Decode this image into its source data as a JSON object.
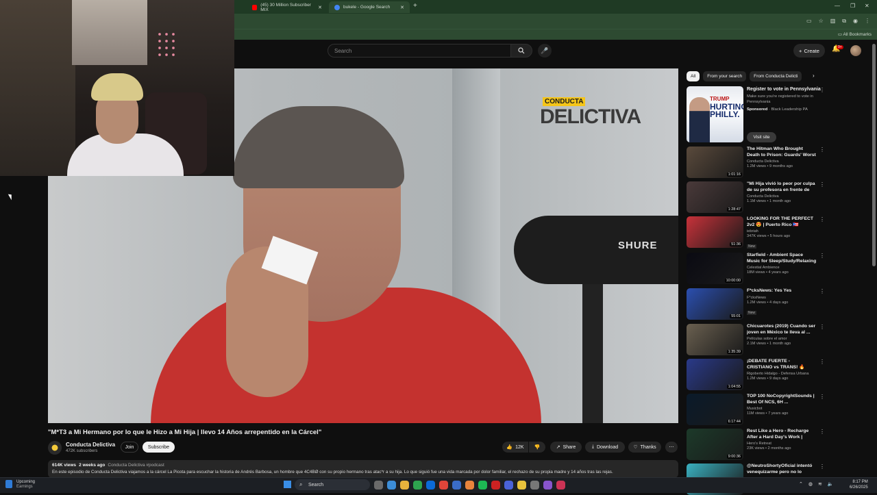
{
  "browser": {
    "tabs": [
      {
        "label": "(45) 30 Million Subscriber MIX",
        "favicon_color": "#ff0000"
      },
      {
        "label": "bukele - Google Search",
        "favicon_color": "#4285f4"
      }
    ],
    "bookmarks_label": "All Bookmarks"
  },
  "youtube": {
    "search_placeholder": "Search",
    "create_label": "Create",
    "notif_count": "9+"
  },
  "video": {
    "overlay_logo_small": "CONDUCTA",
    "overlay_logo_big": "DELICTIVA",
    "mic_brand": "SHURE",
    "title": "\"M*T3 a Mi Hermano por lo que le Hizo a Mi Hija | llevo 14 Años arrepentido en la Cárcel\"",
    "channel": "Conducta Delictiva",
    "subscribers": "472K subscribers",
    "join_label": "Join",
    "subscribe_label": "Subscribe",
    "likes": "12K",
    "share_label": "Share",
    "download_label": "Download",
    "thanks_label": "Thanks",
    "views": "614K views",
    "age": "2 weeks ago",
    "tags": "Conducta Delictiva #podcast",
    "description": "En este episodio de Conducta Delictiva viajamos a la cárcel La Picota para escuchar la historia de Andrés Barbosa, un hombre que 4C4BØ con su propio hermano tras atac*r a su hija. Lo que siguió fue una vida marcada por dolor familiar, el rechazo de su propia madre y 14 años tras las rejas."
  },
  "sidebar": {
    "chips": [
      "All",
      "From your search",
      "From Conducta Delicti"
    ],
    "ad": {
      "thumb_line1": "TRUMP",
      "thumb_line2": "HURTING PHILLY.",
      "title": "Register to vote in Pennsylvania",
      "subtitle": "Make sure you're registered to vote in Pennsylvania",
      "sponsored": "Sponsored",
      "advertiser": "Black Leadership PA",
      "visit_label": "Visit site"
    },
    "recs": [
      {
        "title": "The Hitman Who Brought Death to Prison: Guards' Worst ...",
        "channel": "Conducta Delictiva",
        "meta": "1.2M views • 9 months ago",
        "duration": "1:01:16",
        "color": "#5a4a3c"
      },
      {
        "title": "\"Mi Hija vivió lo peor por culpa de su profesora en frente de s...",
        "channel": "Conducta Delictiva",
        "meta": "1.1M views • 1 month ago",
        "duration": "1:28:47",
        "color": "#4a3a3a"
      },
      {
        "title": "LOOKING FOR THE PERFECT 2v2 😍 | Puerto Rico 🇵🇷",
        "channel": "iebriah",
        "meta": "347K views • 5 hours ago",
        "duration": "51:36",
        "color": "#c8323a",
        "new": "New"
      },
      {
        "title": "Starfield - Ambient Space Music for Sleep/Study/Relaxing 10 ...",
        "channel": "Celestial Ambience",
        "meta": "18M views • 4 years ago",
        "duration": "10:00:00",
        "color": "#0a0a12"
      },
      {
        "title": "F*cksNews: Yes Yes",
        "channel": "F*cksNews",
        "meta": "1.2M views • 4 days ago",
        "duration": "55:01",
        "color": "#2b4fb0",
        "new": "New"
      },
      {
        "title": "Chicuarotes (2019) Cuando ser joven en México te lleva al ...",
        "channel": "Películas sobre el amor",
        "meta": "2.1M views • 1 month ago",
        "duration": "1:35:39",
        "color": "#6a6050"
      },
      {
        "title": "¡DEBATE FUERTE - CRISTIANO vs TRANS! 🔥",
        "channel": "Rigoberto Hidalgo - Defensa Urbana",
        "meta": "1.2M views • 9 days ago",
        "duration": "1:04:55",
        "color": "#2a3a8a"
      },
      {
        "title": "TOP 100 NoCopyrightSounds | Best Of NCS, 6H ...",
        "channel": "Musicbot",
        "meta": "11M views • 7 years ago",
        "duration": "6:17:44",
        "color": "#0a1a2a"
      },
      {
        "title": "Rest Like a Hero - Recharge After a Hard Day's Work | Goku...",
        "channel": "Hero's Retreat",
        "meta": "23K views • 2 months ago",
        "duration": "9:00:36",
        "color": "#1c3a2a"
      },
      {
        "title": "@NeutroShortyOficial intentó venequizarme pero no lo logró...",
        "channel": "",
        "meta": "",
        "duration": "",
        "color": "#3ab0c0"
      }
    ]
  },
  "taskbar": {
    "earnings_title": "Upcoming",
    "earnings_sub": "Earnings",
    "search_label": "Search",
    "time": "8:17 PM",
    "date": "6/26/2025"
  }
}
